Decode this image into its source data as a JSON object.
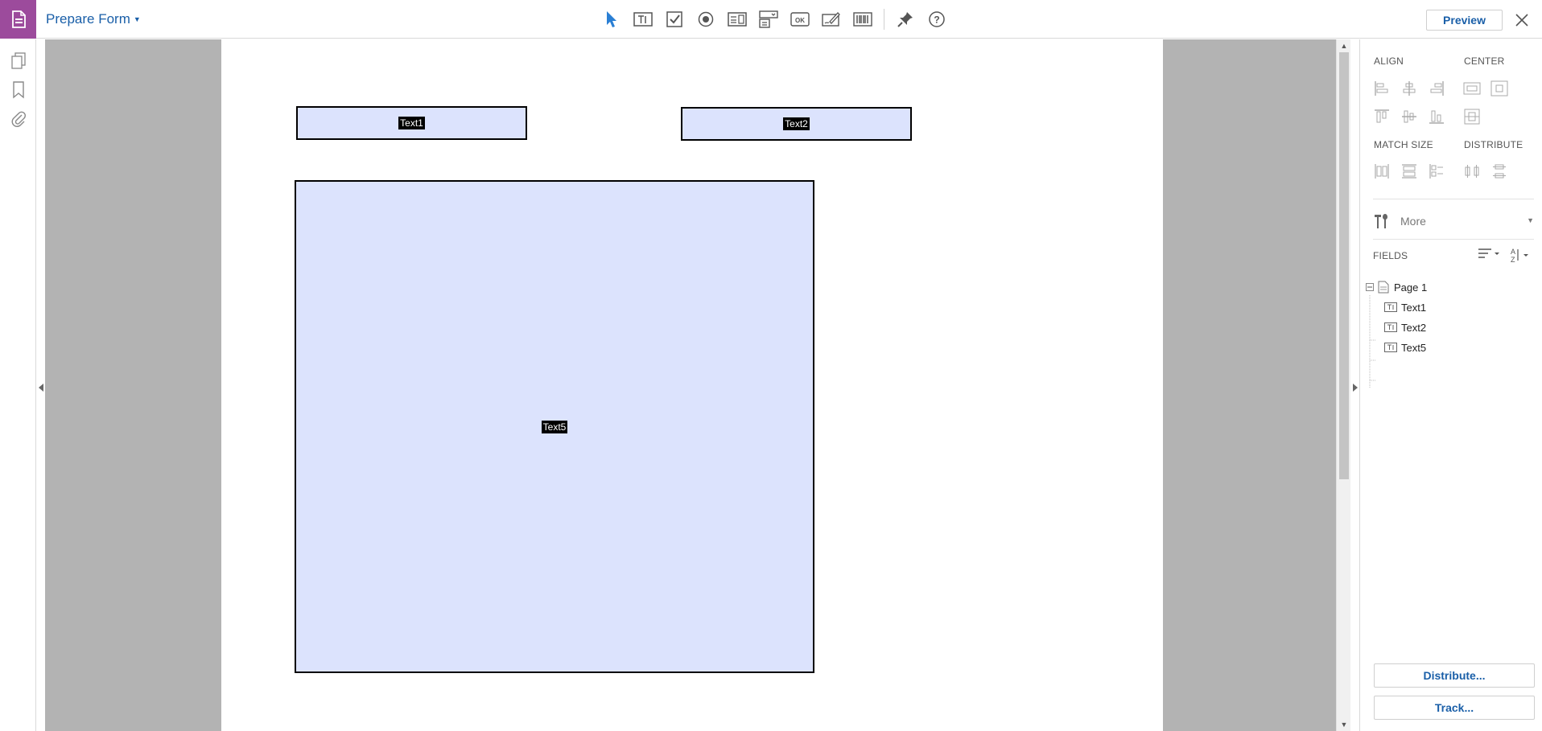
{
  "header": {
    "title": "Prepare Form",
    "preview_label": "Preview",
    "tool_icons": [
      "select-pointer",
      "text-field",
      "checkbox",
      "radio-button",
      "list-box",
      "dropdown",
      "button",
      "digital-signature",
      "barcode",
      "pin",
      "help"
    ]
  },
  "colors": {
    "brand": "#9c4b9c",
    "link": "#1a5fa8",
    "field_fill": "#dce3fd",
    "canvas_bg": "#b3b3b3"
  },
  "form": {
    "fields": [
      {
        "label": "Text1"
      },
      {
        "label": "Text2"
      },
      {
        "label": "Text5"
      }
    ]
  },
  "panel": {
    "align_label": "ALIGN",
    "center_label": "CENTER",
    "match_size_label": "MATCH SIZE",
    "distribute_label": "DISTRIBUTE",
    "more_label": "More",
    "fields_label": "FIELDS",
    "tree": {
      "page_label": "Page 1",
      "fields": [
        "Text1",
        "Text2",
        "Text5"
      ]
    },
    "distribute_button": "Distribute...",
    "track_button": "Track..."
  }
}
